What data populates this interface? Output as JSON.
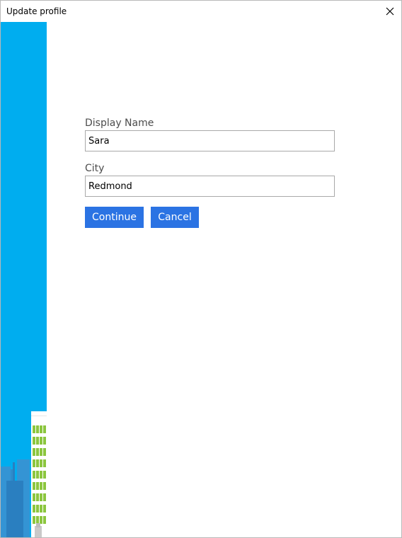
{
  "window": {
    "title": "Update profile",
    "close_icon": "close-icon"
  },
  "form": {
    "display_name": {
      "label": "Display Name",
      "value": "Sara"
    },
    "city": {
      "label": "City",
      "value": "Redmond"
    }
  },
  "buttons": {
    "continue_label": "Continue",
    "cancel_label": "Cancel"
  },
  "colors": {
    "side_panel": "#00adef",
    "button": "#2b73e3",
    "building_windows": "#8cc63f"
  }
}
